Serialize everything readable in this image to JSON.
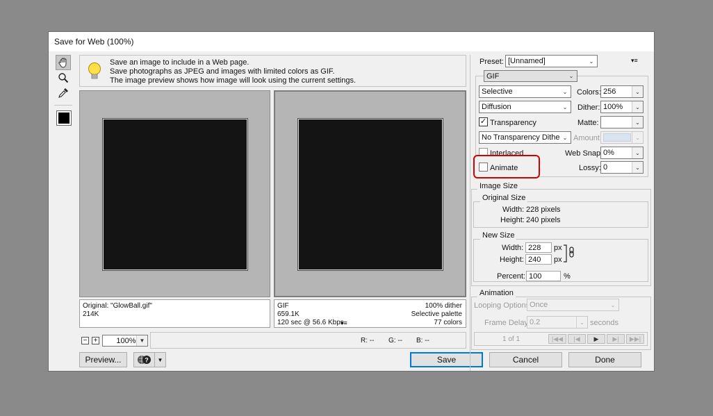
{
  "window": {
    "title": "Save for Web (100%)"
  },
  "tip": {
    "line1": "Save an image to include in a Web page.",
    "line2": "Save photographs as JPEG and images with limited colors as GIF.",
    "line3": "The image preview shows how image will look using the current settings."
  },
  "original_info": {
    "name": "Original: \"GlowBall.gif\"",
    "size": "214K"
  },
  "optimized_info": {
    "format": "GIF",
    "size": "659.1K",
    "time": "120 sec @ 56.6 Kbps",
    "dither": "100% dither",
    "palette": "Selective palette",
    "colors": "77 colors"
  },
  "zoom": {
    "minus": "−",
    "plus": "+",
    "value": "100%"
  },
  "readout": {
    "r": "R: --",
    "g": "G: --",
    "b": "B: --"
  },
  "buttons": {
    "preview": "Preview...",
    "save": "Save",
    "cancel": "Cancel",
    "done": "Done"
  },
  "settings": {
    "preset_label": "Preset:",
    "preset_value": "[Unnamed]",
    "format": "GIF",
    "reduction": "Selective",
    "colors_label": "Colors:",
    "colors_value": "256",
    "dither_algo": "Diffusion",
    "dither_label": "Dither:",
    "dither_value": "100%",
    "transparency_label": "Transparency",
    "matte_label": "Matte:",
    "transparency_dither": "No Transparency Dither",
    "amount_label": "Amount:",
    "interlaced_label": "Interlaced",
    "websnap_label": "Web Snap:",
    "websnap_value": "0%",
    "animate_label": "Animate",
    "lossy_label": "Lossy:",
    "lossy_value": "0"
  },
  "image_size": {
    "legend": "Image Size",
    "original_legend": "Original Size",
    "width_label": "Width:",
    "width_value": "228 pixels",
    "height_label": "Height:",
    "height_value": "240 pixels",
    "new_legend": "New Size",
    "new_width_label": "Width:",
    "new_width": "228",
    "new_height_label": "Height:",
    "new_height": "240",
    "unit": "px",
    "percent_label": "Percent:",
    "percent_value": "100",
    "percent_unit": "%"
  },
  "animation": {
    "legend": "Animation",
    "looping_label": "Looping Options:",
    "looping_value": "Once",
    "delay_label": "Frame Delay:",
    "delay_value": "0.2",
    "delay_unit": "seconds",
    "frame_counter": "1 of 1"
  },
  "colors": {
    "accent": "#0078d7",
    "highlight": "#d40000",
    "swatch": "#000000"
  }
}
